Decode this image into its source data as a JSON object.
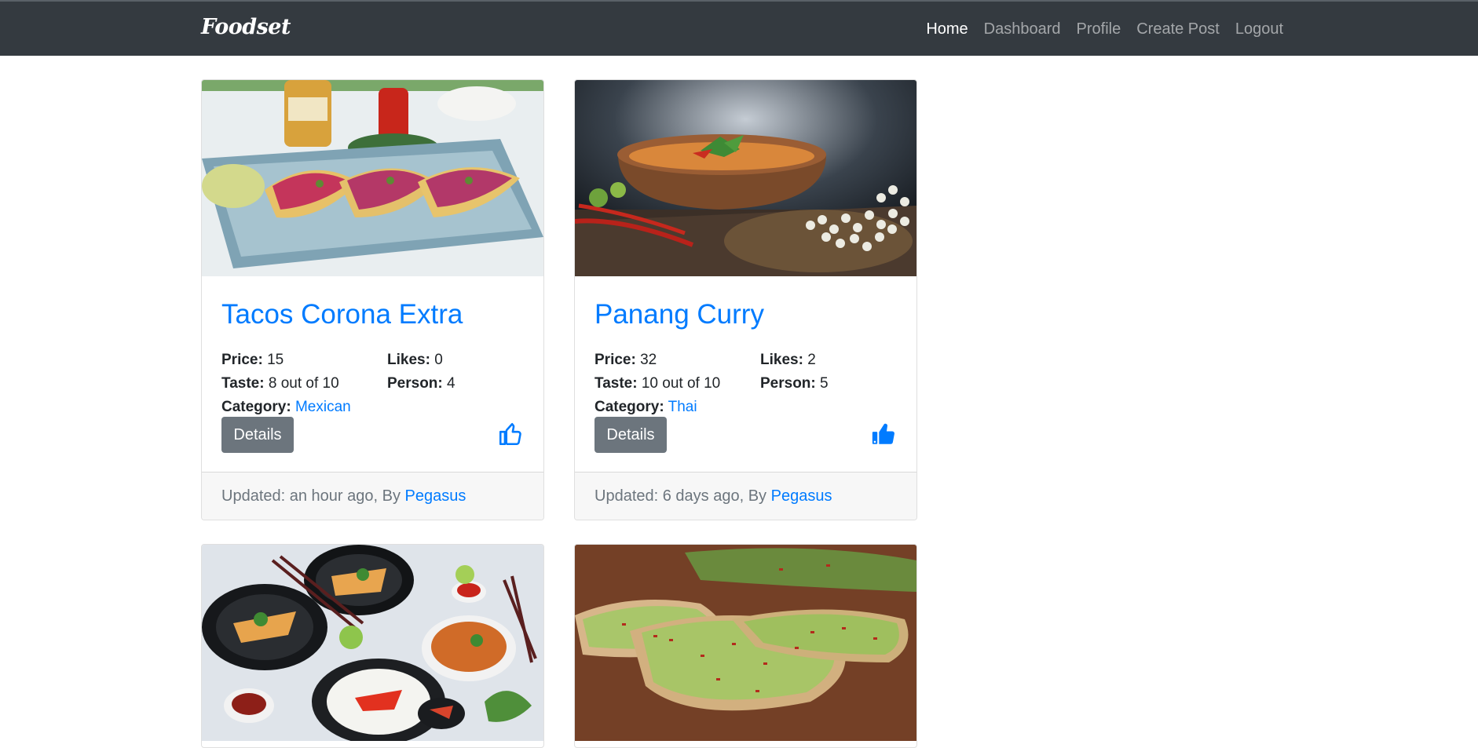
{
  "brand": "Foodset",
  "nav": {
    "home": "Home",
    "dashboard": "Dashboard",
    "profile": "Profile",
    "create_post": "Create Post",
    "logout": "Logout"
  },
  "labels": {
    "price": "Price:",
    "likes": "Likes:",
    "taste": "Taste:",
    "person": "Person:",
    "category": "Category:",
    "details": "Details",
    "by": ", By "
  },
  "posts": [
    {
      "title": "Tacos Corona Extra",
      "price": "15",
      "likes": "0",
      "taste": "8 out of 10",
      "person": "4",
      "category": "Mexican",
      "updated": "Updated: an hour ago",
      "author": "Pegasus",
      "liked": false,
      "like_icon": "thumbs-up-outline-icon"
    },
    {
      "title": "Panang Curry",
      "price": "32",
      "likes": "2",
      "taste": "10 out of 10",
      "person": "5",
      "category": "Thai",
      "updated": "Updated: 6 days ago",
      "author": "Pegasus",
      "liked": true,
      "like_icon": "thumbs-up-filled-icon"
    }
  ],
  "colors": {
    "navbar": "#343a40",
    "link": "#007bff",
    "button": "#6c757d"
  }
}
